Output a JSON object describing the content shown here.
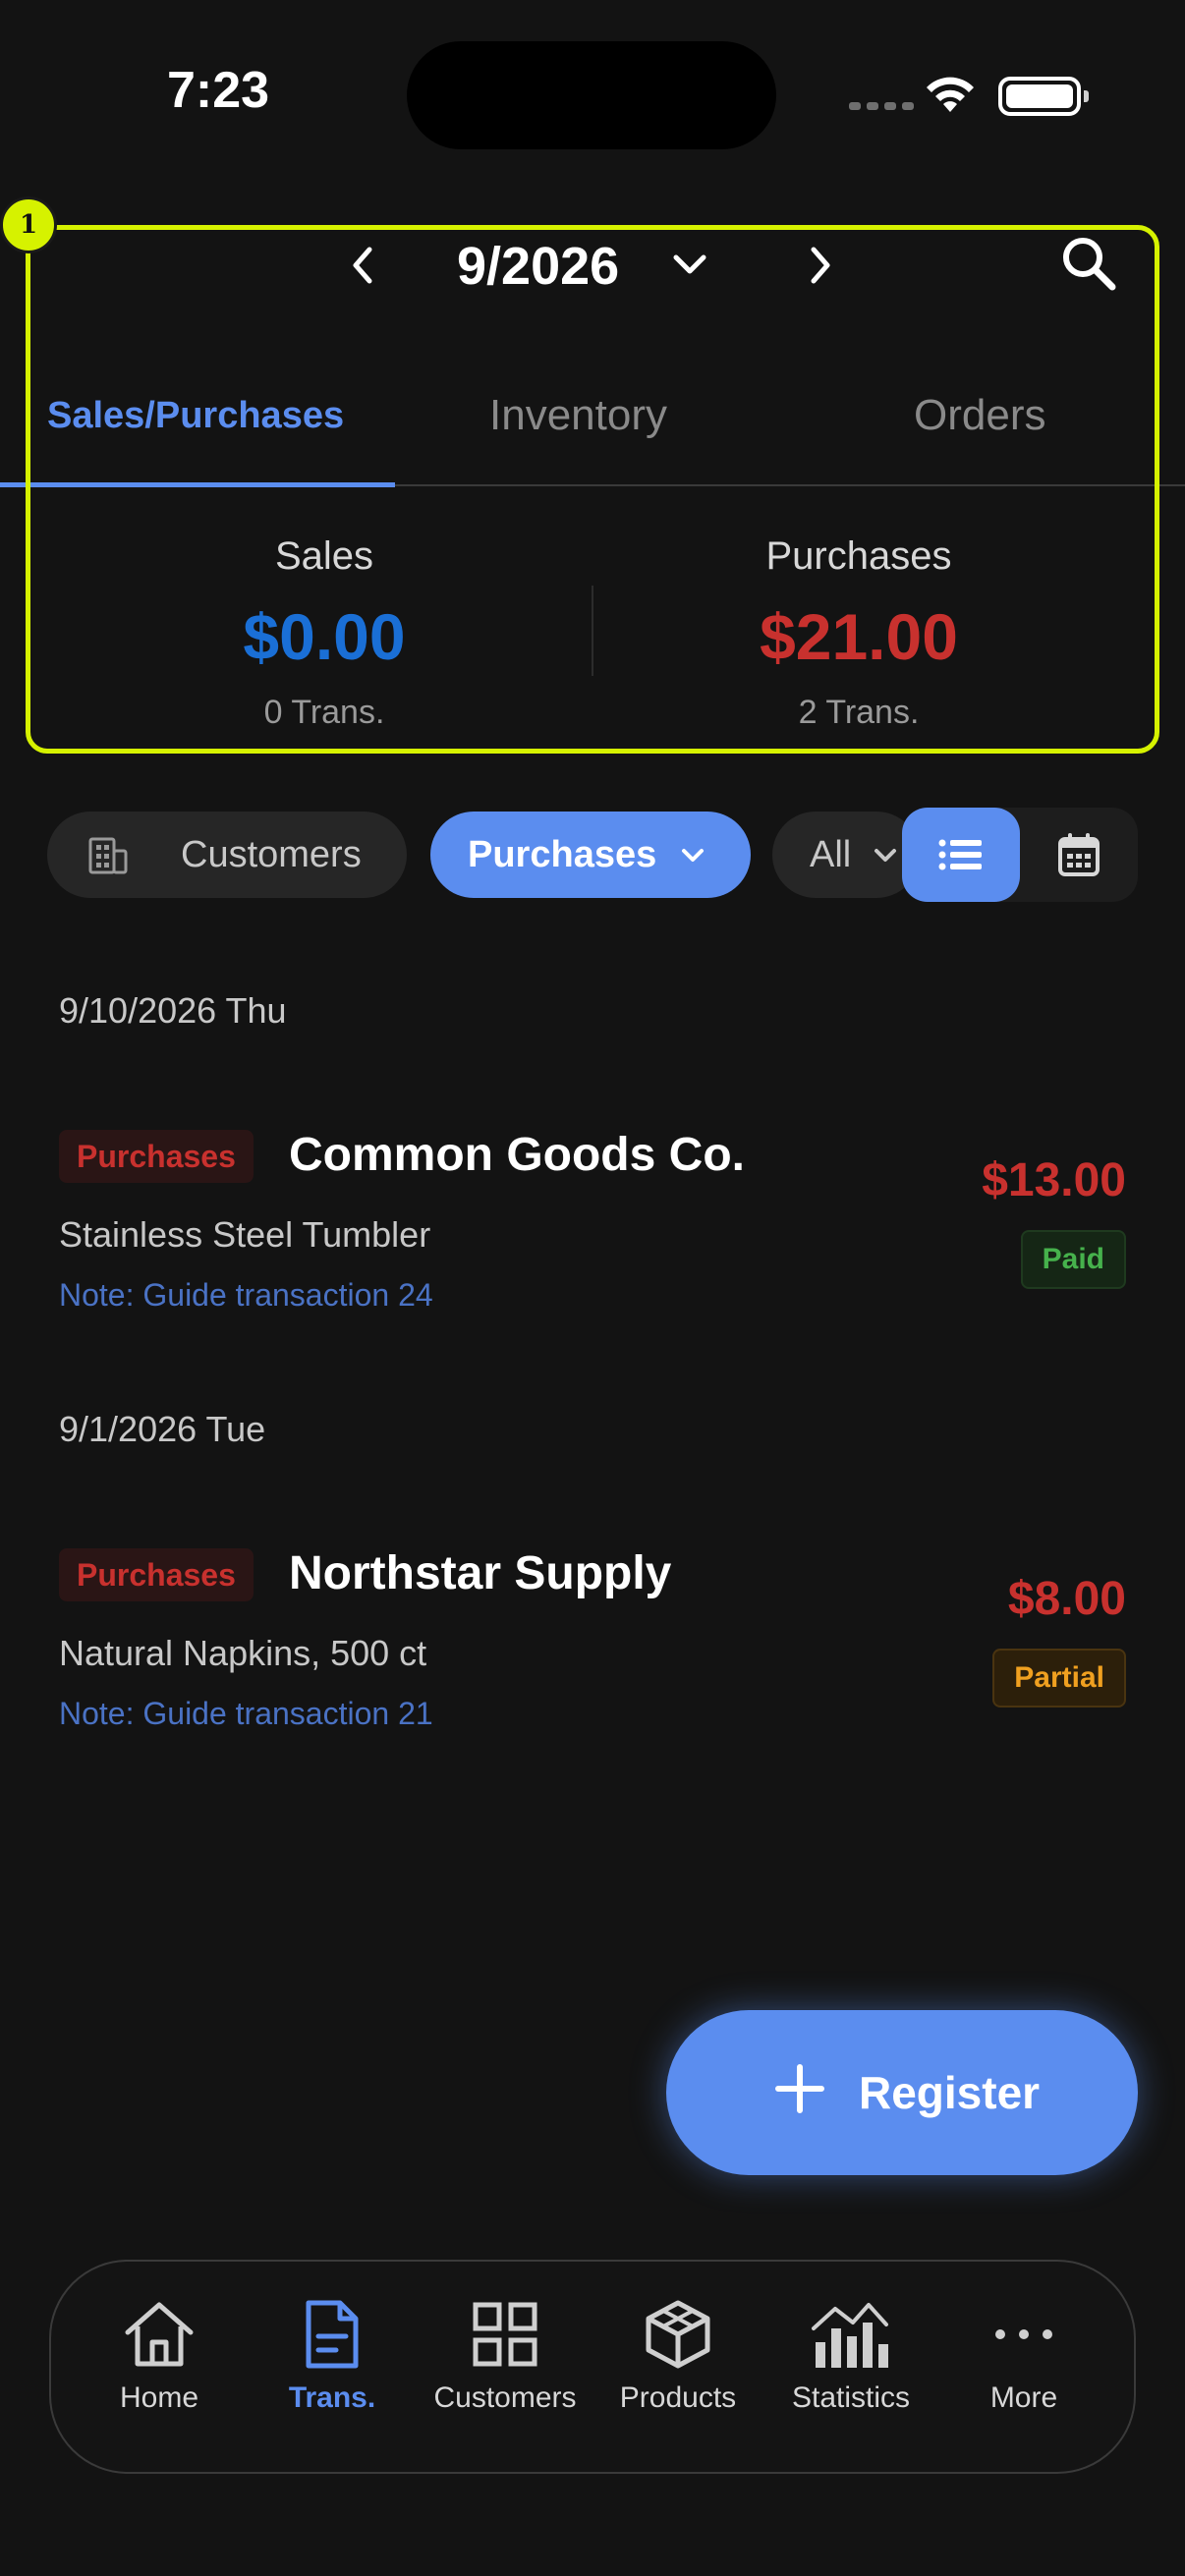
{
  "status_bar": {
    "time": "7:23"
  },
  "header": {
    "month": "9/2026",
    "marker": "1"
  },
  "tabs": [
    {
      "label": "Sales/Purchases",
      "active": true
    },
    {
      "label": "Inventory",
      "active": false
    },
    {
      "label": "Orders",
      "active": false
    }
  ],
  "summary": {
    "sales": {
      "label": "Sales",
      "value": "$0.00",
      "count": "0 Trans.",
      "color": "#1a6fd6"
    },
    "purchases": {
      "label": "Purchases",
      "value": "$21.00",
      "count": "2 Trans.",
      "color": "#c8312e"
    }
  },
  "filters": {
    "customers": "Customers",
    "type": "Purchases",
    "status": "All"
  },
  "transactions": [
    {
      "date": "9/10/2026 Thu",
      "badge": "Purchases",
      "name": "Common Goods Co.",
      "product": "Stainless Steel Tumbler",
      "note": "Note: Guide transaction 24",
      "amount": "$13.00",
      "status": "Paid"
    },
    {
      "date": "9/1/2026 Tue",
      "badge": "Purchases",
      "name": "Northstar Supply",
      "product": "Natural Napkins, 500 ct",
      "note": "Note: Guide transaction 21",
      "amount": "$8.00",
      "status": "Partial"
    }
  ],
  "fab": {
    "label": "Register"
  },
  "bottom_nav": [
    {
      "label": "Home",
      "icon": "home-icon"
    },
    {
      "label": "Trans.",
      "icon": "document-icon",
      "active": true
    },
    {
      "label": "Customers",
      "icon": "grid-icon"
    },
    {
      "label": "Products",
      "icon": "cube-icon"
    },
    {
      "label": "Statistics",
      "icon": "chart-icon"
    },
    {
      "label": "More",
      "icon": "more-icon"
    }
  ],
  "colors": {
    "accent": "#5b8def",
    "highlight": "#d6f200",
    "negative": "#c8312e",
    "positive": "#1a6fd6"
  }
}
